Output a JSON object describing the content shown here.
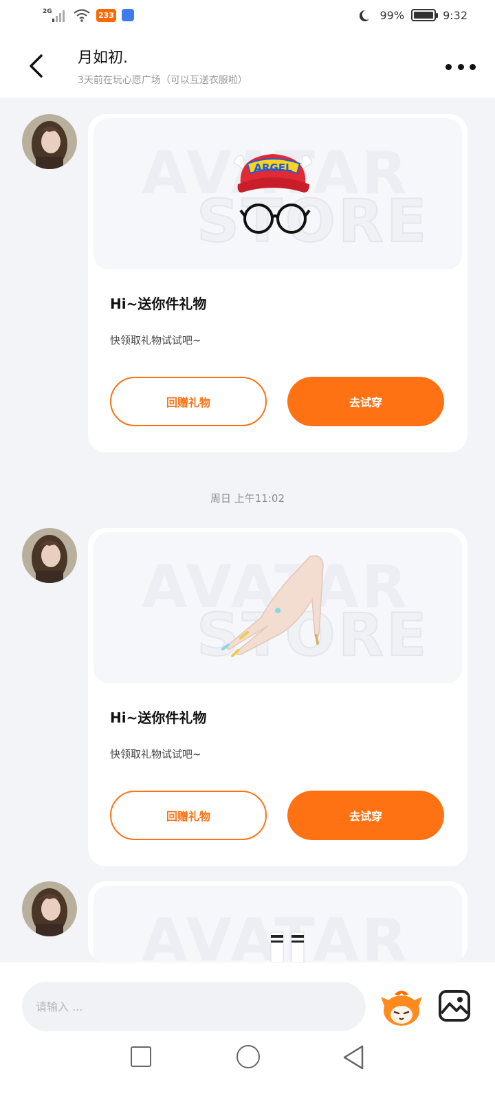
{
  "status_bar": {
    "network": "2G",
    "badge": "233",
    "battery": "99%",
    "time": "9:32"
  },
  "header": {
    "title": "月如初.",
    "subtitle": "3天前在玩心愿广场（可以互送衣服啦）"
  },
  "messages": [
    {
      "card_title": "Hi~送你件礼物",
      "card_desc": "快领取礼物试试吧~",
      "btn_return": "回赠礼物",
      "btn_try": "去试穿",
      "item_icon": "cap-and-glasses",
      "item_text": "ARGEL",
      "watermark_line1": "AVATAR",
      "watermark_line2": "STORE"
    },
    {
      "card_title": "Hi~送你件礼物",
      "card_desc": "快领取礼物试试吧~",
      "btn_return": "回赠礼物",
      "btn_try": "去试穿",
      "item_icon": "hand-with-nails",
      "watermark_line1": "AVATAR",
      "watermark_line2": "STORE"
    },
    {
      "item_icon": "socks",
      "watermark_line1": "AVATAR"
    }
  ],
  "timestamp": "周日 上午11:02",
  "input": {
    "placeholder": "请输入 ..."
  },
  "colors": {
    "accent": "#ff7214",
    "background": "#f2f4f7",
    "card": "#ffffff"
  }
}
